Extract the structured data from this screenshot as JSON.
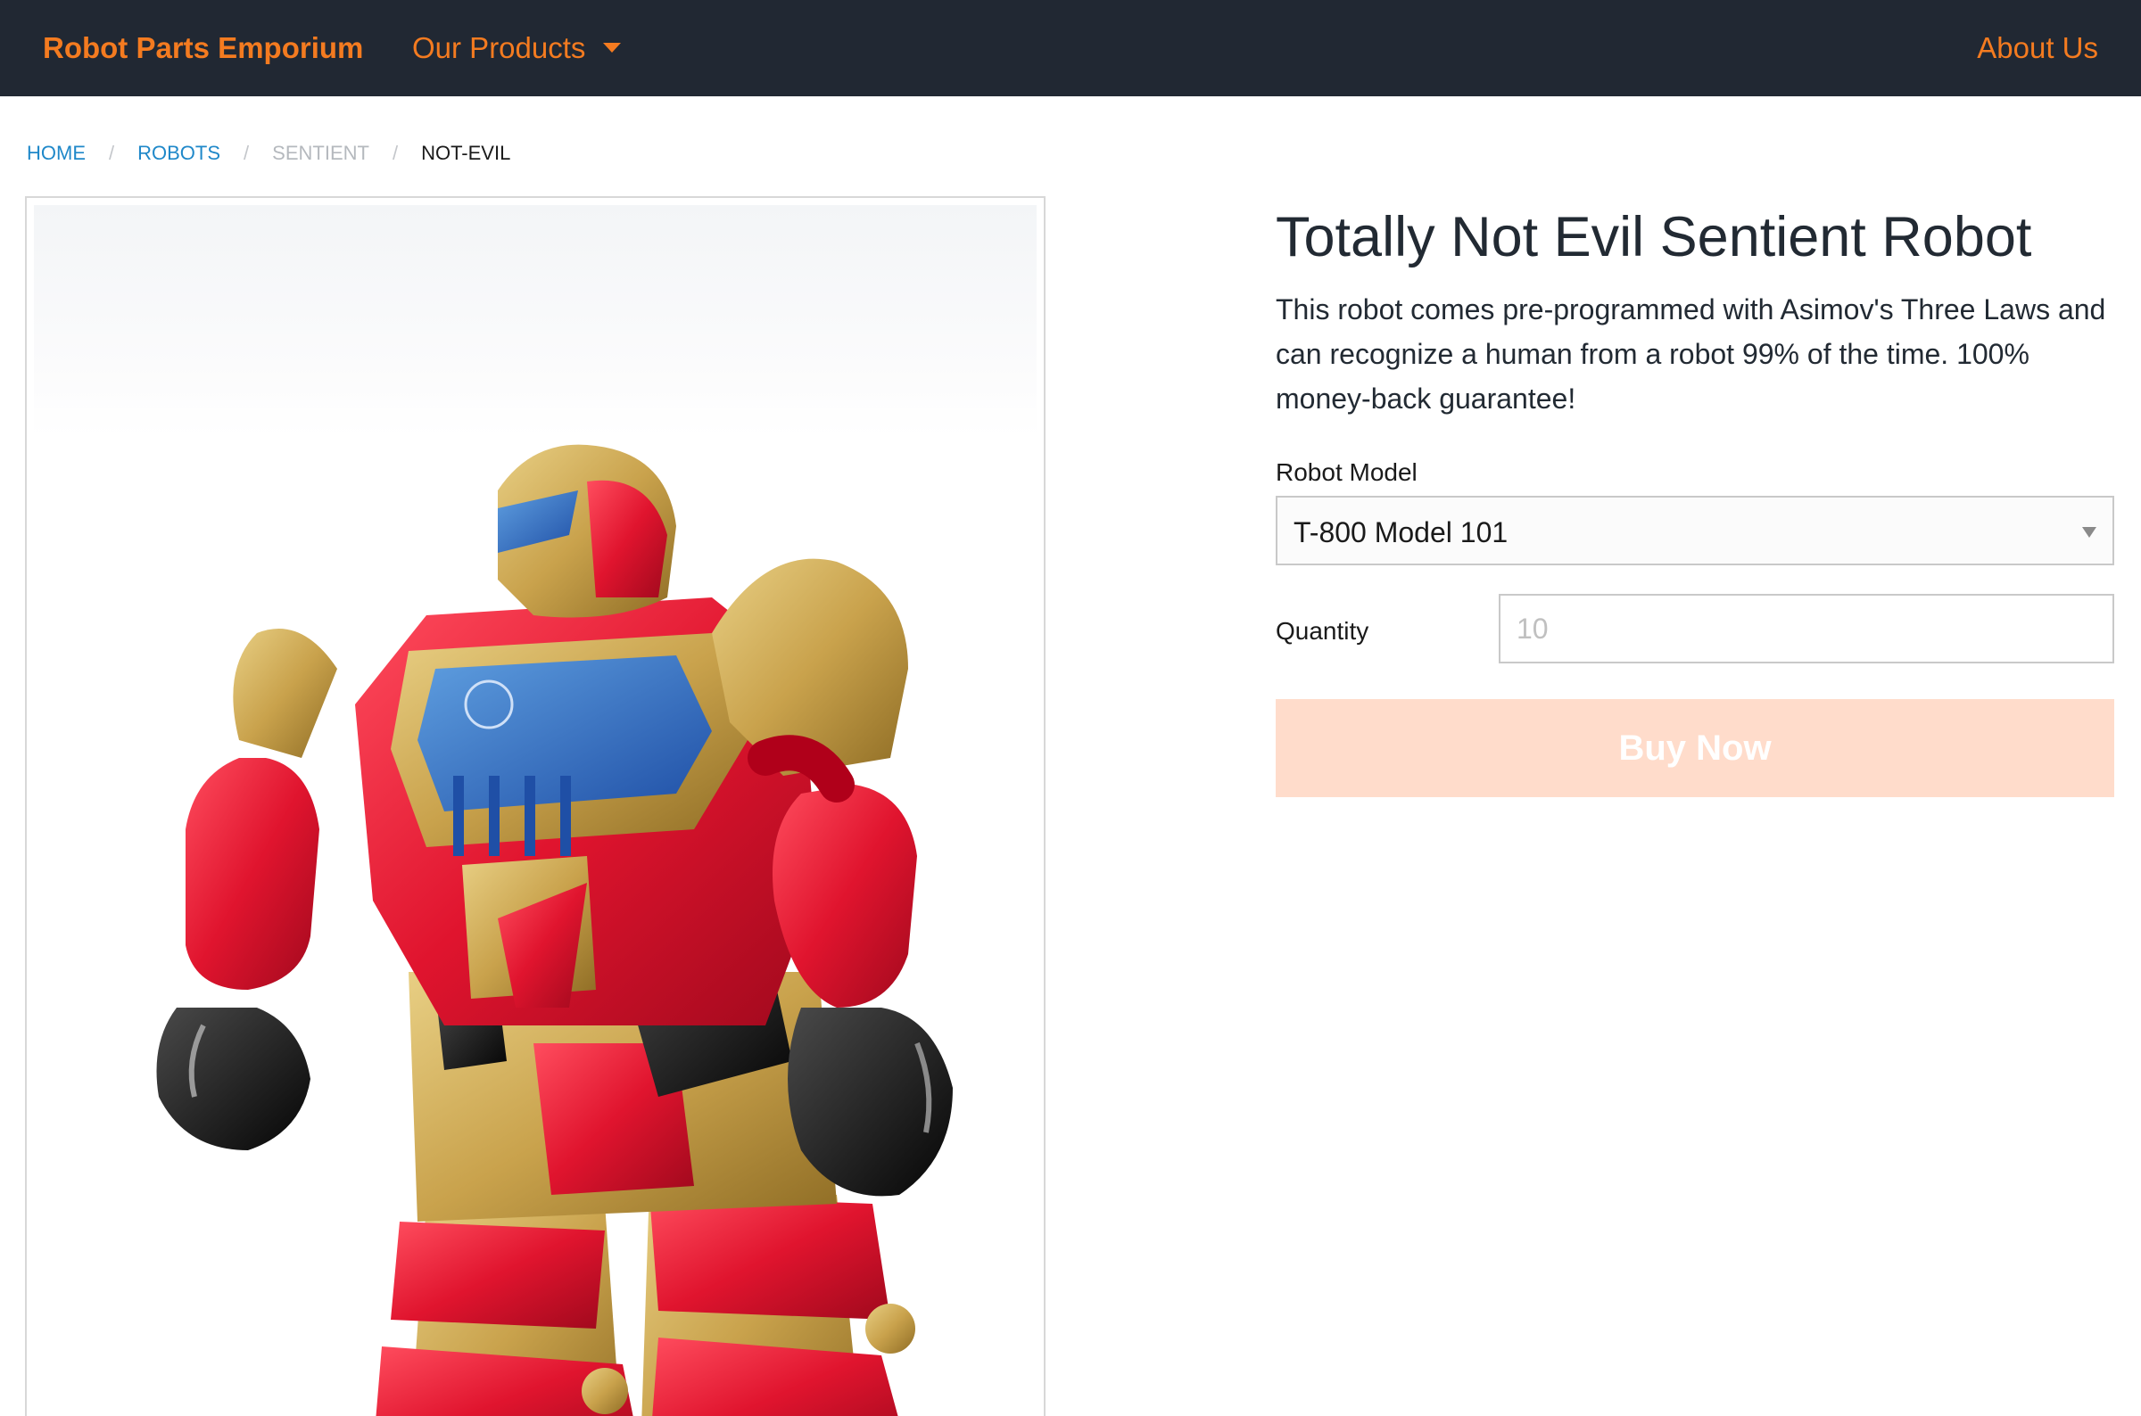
{
  "nav": {
    "brand": "Robot Parts Emporium",
    "products_menu": "Our Products",
    "about": "About Us"
  },
  "breadcrumb": {
    "items": [
      "HOME",
      "ROBOTS",
      "SENTIENT",
      "NOT-EVIL"
    ],
    "separator": "/"
  },
  "product": {
    "title": "Totally Not Evil Sentient Robot",
    "description": "This robot comes pre-programmed with Asimov's Three Laws and can recognize a human from a robot 99% of the time. 100% money-back guarantee!",
    "model_label": "Robot Model",
    "model_value": "T-800 Model 101",
    "quantity_label": "Quantity",
    "quantity_placeholder": "10",
    "buy_label": "Buy Now",
    "image_icon": "robot-toy-photo"
  },
  "colors": {
    "nav_bg": "#212833",
    "accent": "#f47b20",
    "link": "#1f88c9",
    "button_bg": "#ffdccb"
  }
}
